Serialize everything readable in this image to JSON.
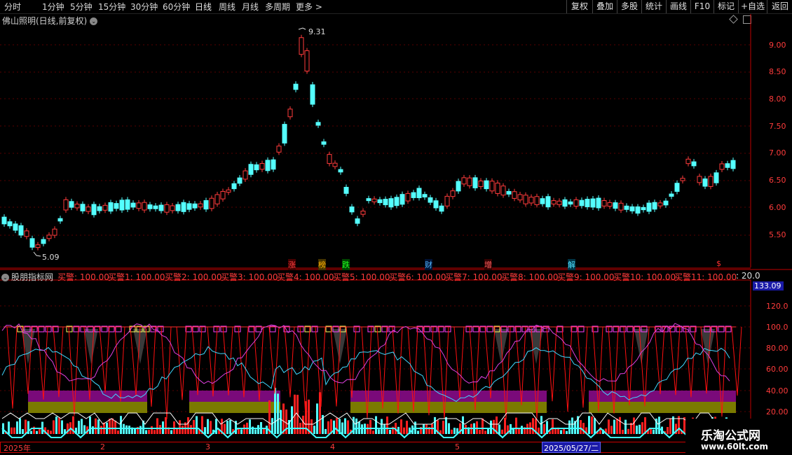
{
  "toolbar": {
    "periods": [
      "分时",
      "1分钟",
      "5分钟",
      "15分钟",
      "30分钟",
      "60分钟",
      "日线",
      "周线",
      "月线",
      "多周期",
      "更多 >"
    ],
    "active_period": "日线",
    "right_buttons": [
      "复权",
      "叠加",
      "多股",
      "统计",
      "画线",
      "F10",
      "标记",
      "+自选",
      "返回"
    ]
  },
  "main_chart": {
    "title": "佛山照明(日线,前复权)",
    "high_label": "9.31",
    "low_label": "5.09",
    "price_ticks": [
      "9.00",
      "8.50",
      "8.00",
      "7.50",
      "7.00",
      "6.50",
      "6.00",
      "5.50"
    ],
    "event_tags": [
      {
        "text": "涨",
        "color": "#ff4040"
      },
      {
        "text": "榜",
        "color": "#ffb000"
      },
      {
        "text": "跌",
        "color": "#20ff20"
      },
      {
        "text": "财",
        "color": "#4fb6ff"
      },
      {
        "text": "增",
        "color": "#ff6060"
      },
      {
        "text": "解",
        "color": "#4fe0ff"
      },
      {
        "text": "$",
        "color": "#ff3030"
      }
    ]
  },
  "indicator": {
    "title": "股朋指标网",
    "signals": [
      "买警: 100.00",
      "买警1: 100.00",
      "买警2: 100.00",
      "买警3: 100.00",
      "买警4: 100.00",
      "买警5: 100.00",
      "买警6: 100.00",
      "买警7: 100.00",
      "买警8: 100.00",
      "买警9: 100.00",
      "买警10: 100.00",
      "买警11: 100.00"
    ],
    "extra_value": ": 20.0",
    "current_value": "133.09",
    "axis_ticks": [
      "120.0",
      "100.0",
      "80.00",
      "60.00",
      "40.00",
      "20.00"
    ]
  },
  "timeline": {
    "labels": [
      "2025年",
      "2",
      "3",
      "4",
      "5"
    ],
    "cursor_date": "2025/05/27/二"
  },
  "watermark": {
    "name": "乐淘公式网",
    "url": "www.60lt.com"
  },
  "colors": {
    "up": "#ff3b3b",
    "down": "#54ffff",
    "purple": "#7a0a7a",
    "olive": "#7a7a00",
    "magenta": "#ff40ff",
    "axis_red": "#c00000"
  }
}
